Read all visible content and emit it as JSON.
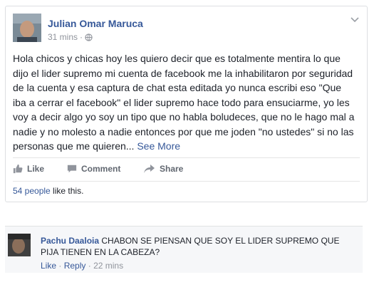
{
  "post": {
    "author": "Julian Omar Maruca",
    "time": "31 mins",
    "separator": "·",
    "text": "Hola chicos y chicas hoy les quiero decir que es totalmente mentira lo que dijo el lider supremo mi cuenta de facebook me la inhabilitaron por seguridad de la cuenta y esa captura de chat esta editada yo nunca escribi eso \"Que iba a cerrar el facebook\" el lider supremo hace todo para ensuciarme, yo les voy a decir algo yo soy un tipo que no habla boludeces, que no le hago mal a nadie y no molesto a nadie entonces por que me joden \"no ustedes\" si no las personas que me quieren...",
    "see_more": "See More"
  },
  "actions": {
    "like": "Like",
    "comment": "Comment",
    "share": "Share"
  },
  "likes": {
    "count": "54 people",
    "suffix": " like this."
  },
  "comment": {
    "author": "Pachu Daaloia",
    "text": "CHABON SE PIENSAN QUE SOY EL LIDER SUPREMO QUE PIJA TIENEN EN LA CABEZA?",
    "like": "Like",
    "reply": "Reply",
    "separator": "·",
    "time": "22 mins"
  },
  "icons": {
    "privacy": "globe-icon",
    "chevron": "chevron-down-icon",
    "like": "thumbs-up-icon",
    "comment": "comment-bubble-icon",
    "share": "share-arrow-icon"
  },
  "colors": {
    "link": "#365899",
    "muted": "#90949c",
    "action": "#616770"
  }
}
